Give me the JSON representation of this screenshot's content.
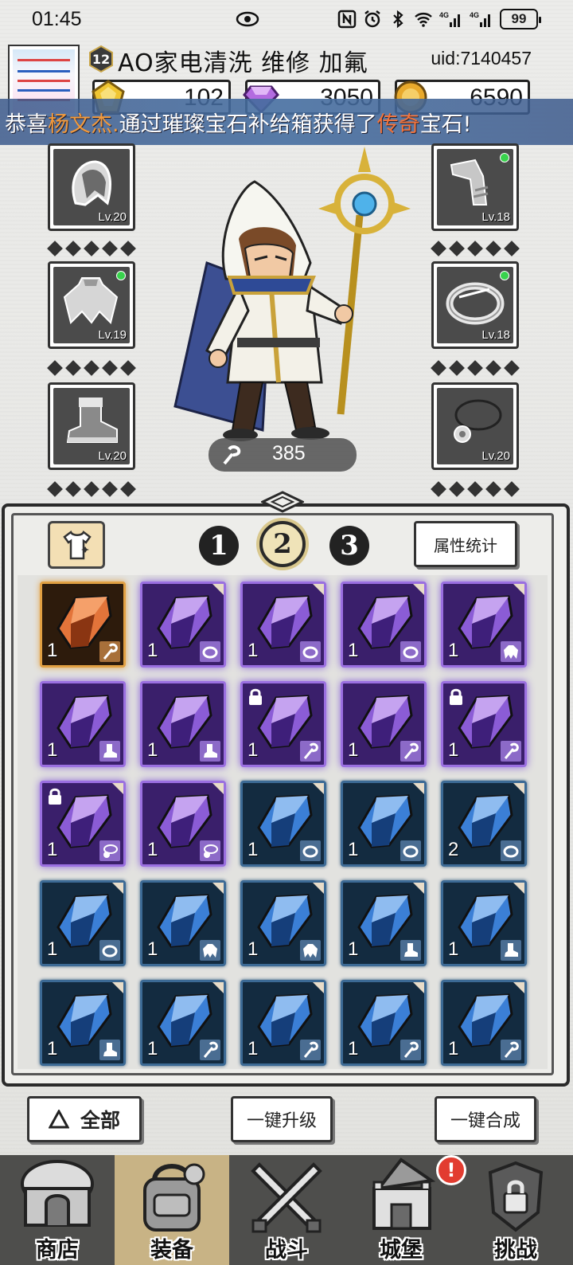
{
  "status_bar": {
    "time": "01:45",
    "battery": "99",
    "signal_1": "4G",
    "signal_2": "4G"
  },
  "player": {
    "level": "12",
    "name": "AO家电清洗 维修 加氟",
    "uid": "uid:7140457"
  },
  "currencies": [
    {
      "name": "gold-gem",
      "value": "102",
      "color": "#f0c531"
    },
    {
      "name": "diamond",
      "value": "3050",
      "color": "#b36be0"
    },
    {
      "name": "coin",
      "value": "6590",
      "color": "#e8a92c"
    }
  ],
  "marquee": {
    "prefix": "恭喜",
    "player": "杨文杰.",
    "middle": "通过璀璨宝石补给箱获得了",
    "rarity": "传奇",
    "suffix": "宝石!"
  },
  "equipment": {
    "left": [
      {
        "item": "hood",
        "level": "Lv.20",
        "upgradable": false
      },
      {
        "item": "cloak",
        "level": "Lv.19",
        "upgradable": true
      },
      {
        "item": "boots",
        "level": "Lv.20",
        "upgradable": false
      }
    ],
    "right": [
      {
        "item": "bracer",
        "level": "Lv.18",
        "upgradable": true
      },
      {
        "item": "ring",
        "level": "Lv.18",
        "upgradable": true
      },
      {
        "item": "necklace",
        "level": "Lv.20",
        "upgradable": false
      }
    ]
  },
  "hero": {
    "power": "385"
  },
  "inventory": {
    "tabs": [
      "1",
      "2",
      "3"
    ],
    "active_tab": "2",
    "stats_button": "属性统计",
    "gems": [
      {
        "rarity": "orange",
        "count": "1",
        "slot": "staff",
        "locked": false,
        "new": false
      },
      {
        "rarity": "purple",
        "count": "1",
        "slot": "ring",
        "locked": false,
        "new": true
      },
      {
        "rarity": "purple",
        "count": "1",
        "slot": "ring",
        "locked": false,
        "new": true
      },
      {
        "rarity": "purple",
        "count": "1",
        "slot": "ring",
        "locked": false,
        "new": true
      },
      {
        "rarity": "purple",
        "count": "1",
        "slot": "cloak",
        "locked": false,
        "new": true
      },
      {
        "rarity": "purple",
        "count": "1",
        "slot": "boots",
        "locked": false,
        "new": false
      },
      {
        "rarity": "purple",
        "count": "1",
        "slot": "boots",
        "locked": false,
        "new": false
      },
      {
        "rarity": "purple",
        "count": "1",
        "slot": "staff",
        "locked": true,
        "new": false
      },
      {
        "rarity": "purple",
        "count": "1",
        "slot": "staff",
        "locked": false,
        "new": false
      },
      {
        "rarity": "purple",
        "count": "1",
        "slot": "staff",
        "locked": true,
        "new": false
      },
      {
        "rarity": "purple",
        "count": "1",
        "slot": "necklace",
        "locked": true,
        "new": true
      },
      {
        "rarity": "purple",
        "count": "1",
        "slot": "necklace",
        "locked": false,
        "new": true
      },
      {
        "rarity": "blue",
        "count": "1",
        "slot": "ring",
        "locked": false,
        "new": true
      },
      {
        "rarity": "blue",
        "count": "1",
        "slot": "ring",
        "locked": false,
        "new": true
      },
      {
        "rarity": "blue",
        "count": "2",
        "slot": "ring",
        "locked": false,
        "new": true
      },
      {
        "rarity": "blue",
        "count": "1",
        "slot": "ring",
        "locked": false,
        "new": true
      },
      {
        "rarity": "blue",
        "count": "1",
        "slot": "cloak",
        "locked": false,
        "new": true
      },
      {
        "rarity": "blue",
        "count": "1",
        "slot": "cloak",
        "locked": false,
        "new": true
      },
      {
        "rarity": "blue",
        "count": "1",
        "slot": "boots",
        "locked": false,
        "new": true
      },
      {
        "rarity": "blue",
        "count": "1",
        "slot": "boots",
        "locked": false,
        "new": true
      },
      {
        "rarity": "blue",
        "count": "1",
        "slot": "boots",
        "locked": false,
        "new": true
      },
      {
        "rarity": "blue",
        "count": "1",
        "slot": "staff",
        "locked": false,
        "new": true
      },
      {
        "rarity": "blue",
        "count": "1",
        "slot": "staff",
        "locked": false,
        "new": true
      },
      {
        "rarity": "blue",
        "count": "1",
        "slot": "staff",
        "locked": false,
        "new": true
      },
      {
        "rarity": "blue",
        "count": "1",
        "slot": "staff",
        "locked": false,
        "new": true
      }
    ]
  },
  "actions": {
    "filter_all": "全部",
    "upgrade_all": "一键升级",
    "merge_all": "一键合成"
  },
  "nav": [
    {
      "label": "商店",
      "icon": "shop-icon",
      "active": false
    },
    {
      "label": "装备",
      "icon": "backpack-icon",
      "active": true
    },
    {
      "label": "战斗",
      "icon": "swords-icon",
      "active": false
    },
    {
      "label": "城堡",
      "icon": "castle-icon",
      "active": false,
      "alert": "!"
    },
    {
      "label": "挑战",
      "icon": "locked-challenge-icon",
      "active": false
    }
  ],
  "colors": {
    "orange_gem": "#e3743a",
    "purple_gem": "#9a6fe0",
    "blue_gem": "#3b7fd6",
    "marquee_highlight": "#f39a3c",
    "active_nav": "#c8b385"
  }
}
